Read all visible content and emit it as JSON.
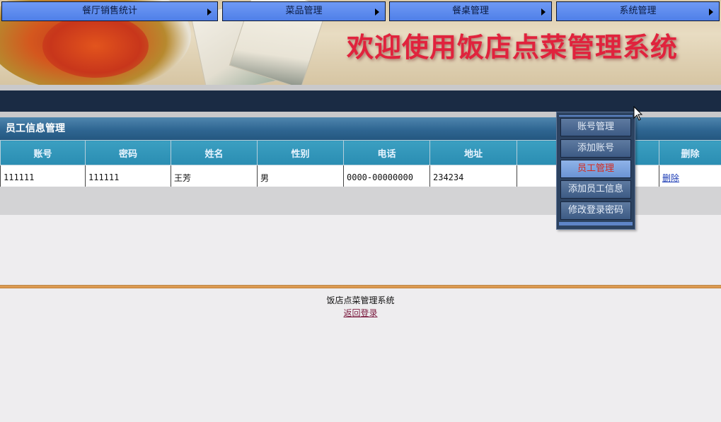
{
  "banner": {
    "title": "欢迎使用饭店点菜管理系统"
  },
  "nav": {
    "items": [
      {
        "label": "餐厅销售统计"
      },
      {
        "label": "菜品管理"
      },
      {
        "label": "餐桌管理"
      },
      {
        "label": "系统管理"
      }
    ]
  },
  "dropdown": {
    "items": [
      {
        "label": "账号管理"
      },
      {
        "label": "添加账号"
      },
      {
        "label": "员工管理"
      },
      {
        "label": "添加员工信息"
      },
      {
        "label": "修改登录密码"
      }
    ],
    "active_index": 2
  },
  "section": {
    "title": "员工信息管理"
  },
  "table": {
    "headers": [
      "账号",
      "密码",
      "姓名",
      "性别",
      "电话",
      "地址",
      "",
      "删除"
    ],
    "rows": [
      {
        "account": "111111",
        "password": "111111",
        "name": "王芳",
        "gender": "男",
        "phone": "0000-00000000",
        "address": "234234",
        "extra": "",
        "delete": "删除"
      }
    ]
  },
  "footer": {
    "text": "饭店点菜管理系统",
    "link": "返回登录"
  },
  "colors": {
    "nav_blue": "#5a88ee",
    "header_teal": "#2a8db2",
    "title_red": "#e0233d",
    "active_menu_text": "#d6291c"
  }
}
